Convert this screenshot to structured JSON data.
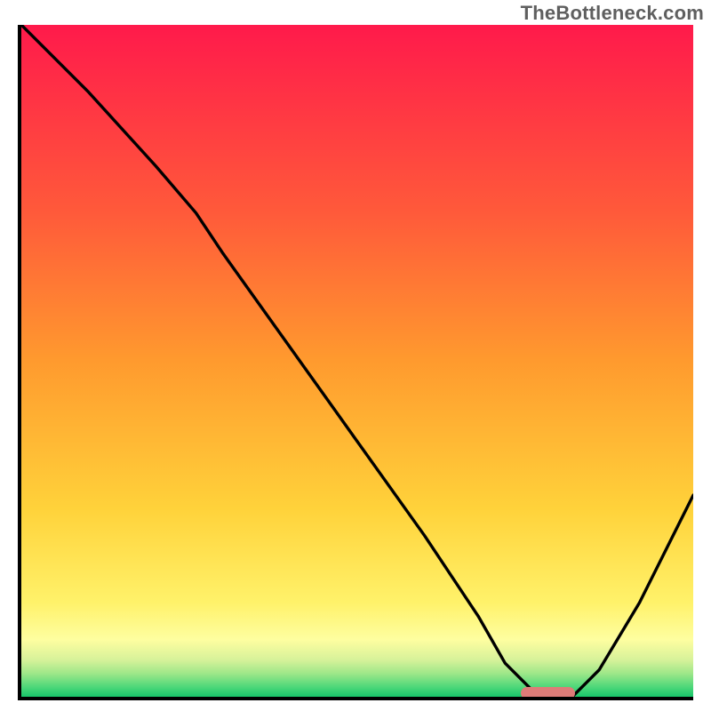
{
  "watermark": "TheBottleneck.com",
  "chart_data": {
    "type": "line",
    "title": "",
    "xlabel": "",
    "ylabel": "",
    "xlim": [
      0,
      100
    ],
    "ylim": [
      0,
      100
    ],
    "grid": false,
    "legend": false,
    "gradient_stops": [
      {
        "offset": 0,
        "color": "#ff1a4b"
      },
      {
        "offset": 0.28,
        "color": "#ff5a3a"
      },
      {
        "offset": 0.5,
        "color": "#ff9a2e"
      },
      {
        "offset": 0.72,
        "color": "#ffd23a"
      },
      {
        "offset": 0.86,
        "color": "#fff26a"
      },
      {
        "offset": 0.915,
        "color": "#fefea0"
      },
      {
        "offset": 0.945,
        "color": "#d7f29a"
      },
      {
        "offset": 0.965,
        "color": "#9fe789"
      },
      {
        "offset": 0.985,
        "color": "#4fd87a"
      },
      {
        "offset": 1.0,
        "color": "#18c56a"
      }
    ],
    "series": [
      {
        "name": "bottleneck-curve",
        "x": [
          0,
          10,
          20,
          26,
          30,
          40,
          50,
          60,
          68,
          72,
          76,
          80,
          82,
          86,
          92,
          100
        ],
        "y": [
          100,
          90,
          79,
          72,
          66,
          52,
          38,
          24,
          12,
          5,
          1,
          0,
          0,
          4,
          14,
          30
        ]
      }
    ],
    "marker": {
      "x_start": 74,
      "x_end": 82,
      "y": 0,
      "color": "#dd7c78"
    }
  }
}
